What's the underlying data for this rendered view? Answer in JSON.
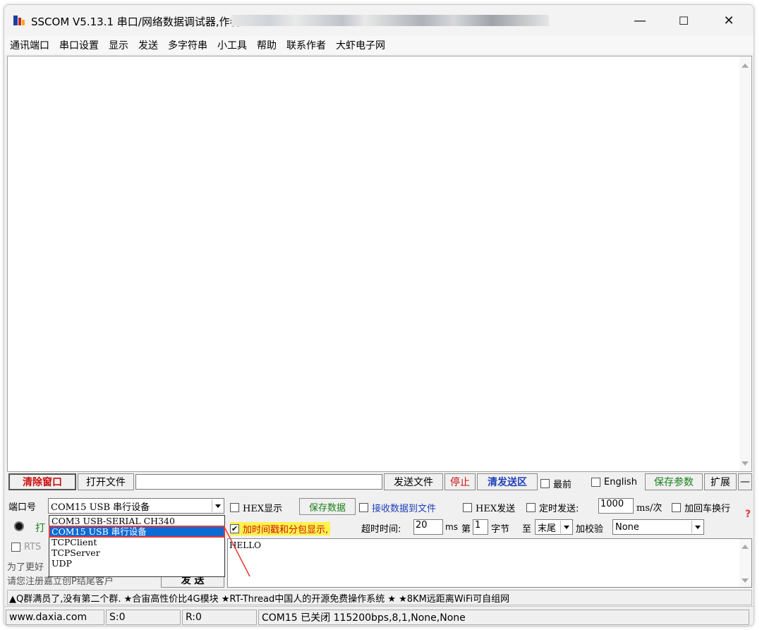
{
  "window": {
    "title": "SSCOM V5.13.1 串口/网络数据调试器,作者",
    "controls": {
      "minimize": "—",
      "maximize": "☐",
      "close": "✕"
    }
  },
  "menu": [
    "通讯端口",
    "串口设置",
    "显示",
    "发送",
    "多字符串",
    "小工具",
    "帮助",
    "联系作者",
    "大虾电子网"
  ],
  "toolbar": {
    "clear_window": "清除窗口",
    "open_file": "打开文件",
    "send_file": "发送文件",
    "stop": "停止",
    "clear_send": "清发送区",
    "topmost": "最前",
    "english": "English",
    "save_params": "保存参数",
    "expand": "扩展",
    "collapse": "—"
  },
  "port": {
    "label": "端口号",
    "selected": "COM15 USB 串行设备",
    "options": [
      "COM3 USB-SERIAL CH340",
      "COM15 USB 串行设备",
      "TCPClient",
      "TCPServer",
      "UDP"
    ],
    "highlighted_index": 1
  },
  "options_row1": {
    "hex_display": "HEX显示",
    "save_data": "保存数据",
    "recv_to_file": "接收数据到文件",
    "hex_send": "HEX发送",
    "timed_send": "定时发送:",
    "interval": "1000",
    "interval_unit": "ms/次",
    "add_crlf": "加回车换行"
  },
  "options_row2": {
    "open_port_partial": "打",
    "timestamp": "加时间戳和分包显示,",
    "timeout_label": "超时时间:",
    "timeout": "20",
    "timeout_unit": "ms",
    "nth": "第",
    "byte_index": "1",
    "byte_label": "字节",
    "to": "至",
    "end": "末尾",
    "checksum_label": "加校验",
    "checksum": "None"
  },
  "left_panel": {
    "rts_partial": "RTS",
    "note_line1": "为了更好",
    "note_line2": "请您注册嘉立创P结尾客户",
    "send_btn": "发 送"
  },
  "send_text": "HELLO",
  "ad_line": "▲Q群满员了,没有第二个群. ★合宙高性价比4G模块 ★RT-Thread中国人的开源免费操作系统 ★ ★8KM远距离WiFi可自组网",
  "status": {
    "site": "www.daxia.com",
    "sent": "S:0",
    "received": "R:0",
    "port_state": "COM15 已关闭  115200bps,8,1,None,None"
  }
}
